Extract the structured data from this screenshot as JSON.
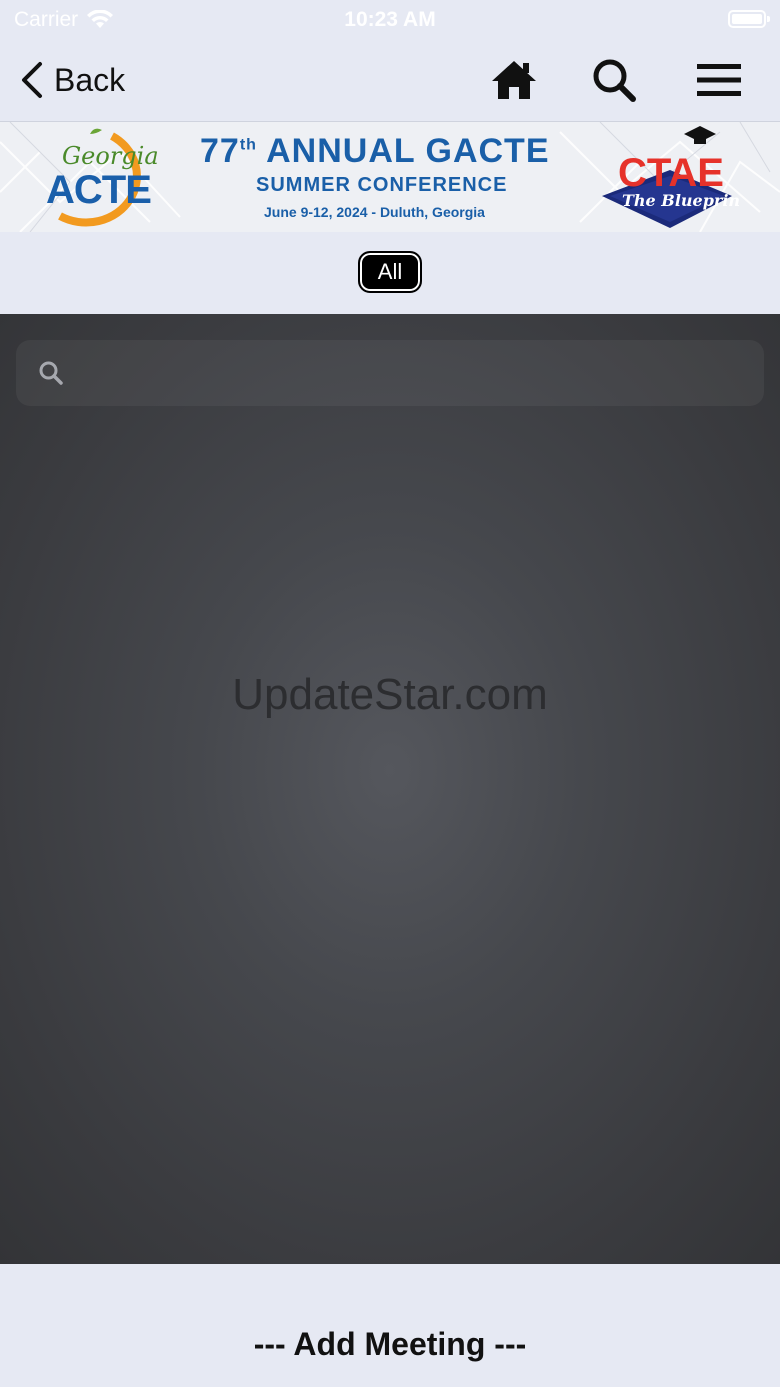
{
  "status_bar": {
    "carrier": "Carrier",
    "time": "10:23 AM"
  },
  "nav": {
    "back_label": "Back",
    "icons": [
      "home-icon",
      "search-icon",
      "menu-icon"
    ]
  },
  "banner": {
    "left_logo_top": "Georgia",
    "left_logo_bottom": "ACTE",
    "title_number": "77",
    "title_suffix": "th",
    "title_rest": " ANNUAL GACTE",
    "subtitle": "SUMMER CONFERENCE",
    "dates": "June 9-12, 2024 - Duluth, Georgia",
    "right_logo_text": "CTAE",
    "right_logo_tagline": "The Blueprint"
  },
  "filter": {
    "selected": "All"
  },
  "search": {
    "placeholder": ""
  },
  "main": {
    "watermark": "UpdateStar.com"
  },
  "footer": {
    "add_meeting": "--- Add Meeting ---"
  },
  "colors": {
    "chrome_bg": "#e6e9f3",
    "banner_blue": "#1a5fa8",
    "content_dark": "#3a3b3f"
  }
}
